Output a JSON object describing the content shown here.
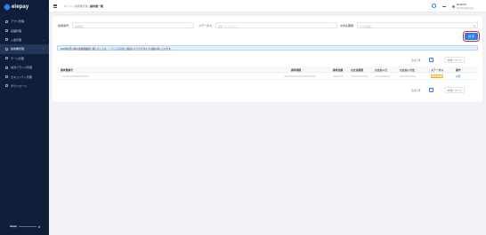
{
  "app": {
    "logo_text": "elepay"
  },
  "sidebar": {
    "items": [
      {
        "label": "アプリ管理",
        "active": false,
        "chevron": false
      },
      {
        "label": "店舗管理",
        "active": false,
        "chevron": false
      },
      {
        "label": "入金管理",
        "active": false,
        "chevron": true
      },
      {
        "label": "請求書管理",
        "active": true,
        "chevron": true
      },
      {
        "label": "チーム管理",
        "active": false,
        "chevron": false
      },
      {
        "label": "決済ブランド管理",
        "active": false,
        "chevron": false
      },
      {
        "label": "セキュリティ管理",
        "active": false,
        "chevron": false
      },
      {
        "label": "ダウンロード",
        "active": false,
        "chevron": false
      }
    ],
    "footer_brand": "elepay"
  },
  "header": {
    "breadcrumbs": [
      "ホーム",
      "請求書管理"
    ],
    "current": "請求書一覧",
    "separator": "/",
    "user_name": "ELEPAY",
    "user_sub": "ELEPAY株式会社"
  },
  "filters": {
    "invoice_no_label": "請求番号：",
    "invoice_no_placeholder": "請求番号",
    "status_label": "ステータス：",
    "status_placeholder": "選択してください",
    "due_label": "お支払期限：",
    "due_placeholder": "日付を選択",
    "search_label": "検 索"
  },
  "notice": {
    "text_before": "2025年4月以降の請求書履歴に関しましては、",
    "link": "こちらの画面",
    "text_after": "をご確認いただけますようお願い申し上げます。"
  },
  "pagination": {
    "total": "合計 1 件",
    "page": "1",
    "per_page": "20 件 / ページ",
    "prev": "‹",
    "next": "›",
    "caret": "⌄"
  },
  "table": {
    "columns": [
      "請求書番号",
      "請求期間",
      "請求金額",
      "お支払期限",
      "お支払い日",
      "お支払い方法",
      "ステータス",
      "操作"
    ],
    "rows": [
      {
        "status": "お支払待ち",
        "action": "詳細"
      }
    ]
  },
  "colors": {
    "sidebar_bg": "#0f1f3a",
    "accent": "#2f7bf5",
    "highlight_outline": "#e02828"
  }
}
